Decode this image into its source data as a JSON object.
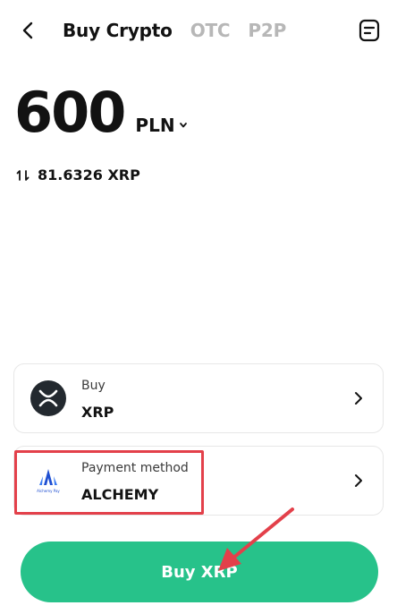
{
  "header": {
    "tabs": [
      {
        "label": "Buy Crypto",
        "active": true
      },
      {
        "label": "OTC",
        "active": false
      },
      {
        "label": "P2P",
        "active": false
      }
    ],
    "back_icon": "chevron-left-icon",
    "orders_icon": "orders-icon"
  },
  "amount": {
    "value": "600",
    "currency": "PLN"
  },
  "conversion": {
    "text": "81.6326 XRP",
    "icon": "swap-icon"
  },
  "buy_card": {
    "label": "Buy",
    "value": "XRP",
    "icon": "xrp-icon"
  },
  "payment_card": {
    "label": "Payment method",
    "value": "ALCHEMY",
    "icon": "alchemy-pay-icon",
    "logo_text": "Alchemy Pay"
  },
  "cta": {
    "label": "Buy XRP"
  },
  "colors": {
    "accent": "#27c28a",
    "highlight": "#e3404a",
    "inactive_tab": "#b7b7b7"
  }
}
